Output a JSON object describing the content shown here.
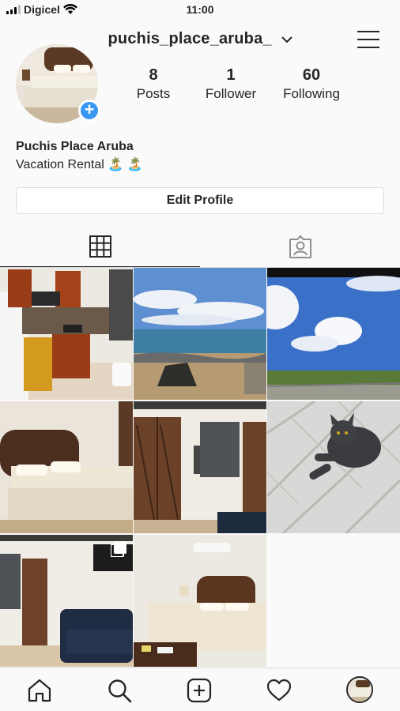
{
  "status": {
    "carrier": "Digicel",
    "time": "11:00"
  },
  "header": {
    "username": "puchis_place_aruba_"
  },
  "profile": {
    "stats": [
      {
        "value": "8",
        "label": "Posts"
      },
      {
        "value": "1",
        "label": "Follower"
      },
      {
        "value": "60",
        "label": "Following"
      }
    ],
    "name": "Puchis Place Aruba",
    "bio": "Vacation Rental 🏝️ 🏝️",
    "edit_label": "Edit Profile"
  },
  "tabs": [
    {
      "icon": "grid-icon",
      "active": true
    },
    {
      "icon": "tagged-icon",
      "active": false
    }
  ],
  "posts": [
    {
      "subject": "kitchen"
    },
    {
      "subject": "beach"
    },
    {
      "subject": "sky"
    },
    {
      "subject": "bedroom"
    },
    {
      "subject": "closet-room"
    },
    {
      "subject": "cat"
    },
    {
      "subject": "living-room",
      "multiple": true
    },
    {
      "subject": "bedroom-2"
    }
  ],
  "bottom_nav": [
    "home-icon",
    "search-icon",
    "add-post-icon",
    "activity-heart-icon",
    "profile-avatar"
  ],
  "colors": {
    "accent": "#3897f0",
    "text": "#262626",
    "border": "#dbdbdb",
    "background": "#fafafa"
  }
}
